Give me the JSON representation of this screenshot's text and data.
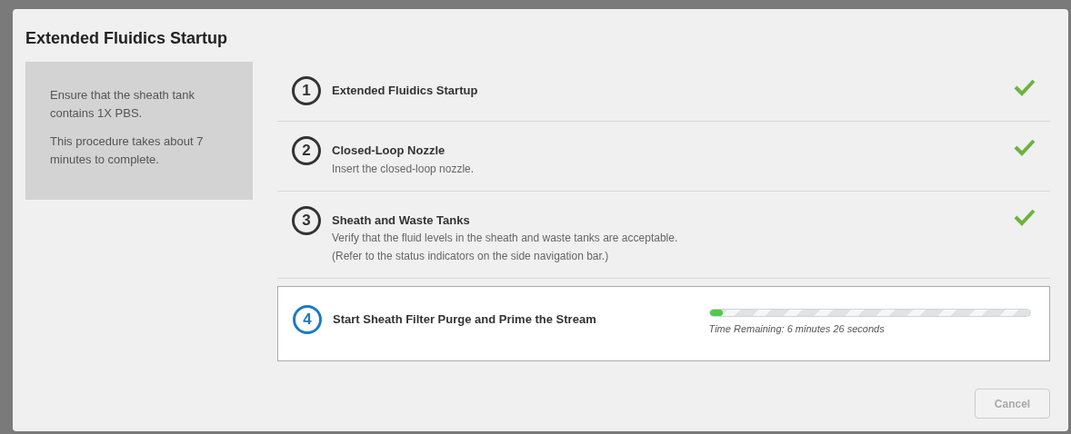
{
  "dialog": {
    "title": "Extended Fluidics Startup"
  },
  "info_panel": {
    "paragraphs": [
      "Ensure that the sheath tank contains 1X PBS.",
      "This procedure takes about 7 minutes to complete."
    ]
  },
  "steps": [
    {
      "number": "1",
      "title": "Extended Fluidics Startup",
      "completed": true,
      "current": false
    },
    {
      "number": "2",
      "title": "Closed-Loop Nozzle",
      "lines": [
        "Insert the closed-loop nozzle."
      ],
      "completed": true,
      "current": false
    },
    {
      "number": "3",
      "title": "Sheath and Waste Tanks",
      "lines": [
        "Verify that the fluid levels in the sheath and waste tanks are acceptable.",
        "(Refer to the status indicators on the side navigation bar.)"
      ],
      "completed": true,
      "current": false
    },
    {
      "number": "4",
      "title": "Start Sheath Filter Purge and Prime the Stream",
      "completed": false,
      "current": true,
      "level": 0.04,
      "time_remaining": "Time Remaining: 6 minutes 26 seconds"
    }
  ],
  "buttons": [
    {
      "label": "Cancel",
      "disabled": true
    }
  ]
}
